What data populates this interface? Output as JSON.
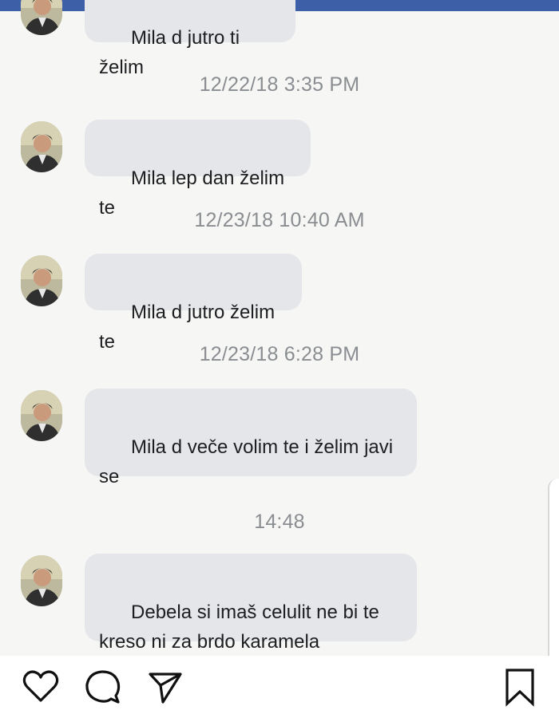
{
  "thread": {
    "items": [
      {
        "type": "message",
        "text": "Mila d jutro ti želim"
      },
      {
        "type": "timestamp",
        "text": "12/22/18 3:35 PM"
      },
      {
        "type": "message",
        "text": "Mila lep dan želim te"
      },
      {
        "type": "timestamp",
        "text": "12/23/18 10:40 AM"
      },
      {
        "type": "message",
        "text": "Mila d jutro želim te"
      },
      {
        "type": "timestamp",
        "text": "12/23/18 6:28 PM"
      },
      {
        "type": "message",
        "text": "Mila d veče volim te i želim javi\nse"
      },
      {
        "type": "timestamp",
        "text": "14:48"
      },
      {
        "type": "message",
        "text": "Debela si imaš celulit ne bi te\nkreso ni za brdo karamela"
      }
    ]
  },
  "actions": {
    "icons": [
      "heart-icon",
      "comment-icon",
      "share-icon",
      "bookmark-icon"
    ]
  },
  "colors": {
    "top_bar": "#3d5fa8",
    "bubble": "#e5e6ea",
    "timestamp": "#8a8d91",
    "background": "#f6f6f4"
  }
}
